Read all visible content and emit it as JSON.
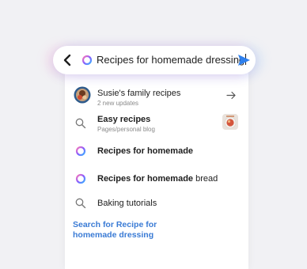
{
  "search": {
    "query": "Recipes for homemade dressing"
  },
  "suggestions": [
    {
      "title": "Susie's family recipes",
      "subtitle": "2 new updates",
      "icon": "avatar",
      "action": "arrow-right-icon"
    },
    {
      "title": "Easy recipes",
      "subtitle": "Pages/personal blog",
      "icon": "magnifier",
      "thumb": "recipe-thumbnail"
    },
    {
      "bold": "Recipes for homemade",
      "rest": "",
      "icon": "ai-ring"
    },
    {
      "bold": "Recipes for homemade",
      "rest": " bread",
      "icon": "ai-ring"
    },
    {
      "bold": "",
      "rest": "Baking tutorials",
      "icon": "magnifier"
    }
  ],
  "search_link": {
    "line1": "Search for Recipe for",
    "line2": "homemade dressing"
  },
  "colors": {
    "accent": "#3a7bd5",
    "send": "#2f80ed"
  }
}
